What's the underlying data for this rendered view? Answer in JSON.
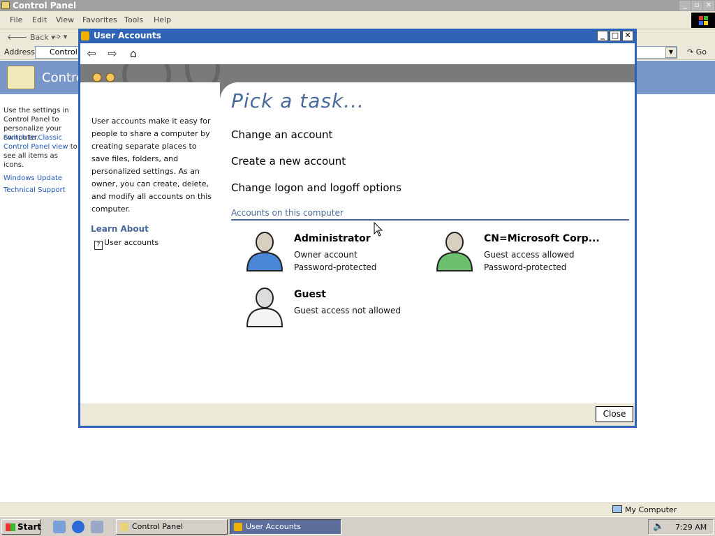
{
  "control_panel": {
    "title": "Control Panel",
    "menu": [
      "File",
      "Edit",
      "View",
      "Favorites",
      "Tools",
      "Help"
    ],
    "toolbar": {
      "back": "Back"
    },
    "address": {
      "label": "Address",
      "value": "Control Panel",
      "go": "Go"
    },
    "header_title": "Control Panel",
    "sidebar": {
      "intro": "Use the settings in Control Panel to personalize your computer.",
      "switch_link": "Switch to Classic Control Panel view",
      "switch_rest": " to see all items as icons.",
      "windows_update": "Windows Update",
      "technical_support": "Technical Support"
    }
  },
  "user_accounts": {
    "title": "User Accounts",
    "description": "User accounts make it easy for people to share a computer by creating separate places to save files, folders, and personalized settings. As an owner, you can create, delete, and modify all accounts on this computer.",
    "learn_about": "Learn About",
    "learn_link": "User accounts",
    "heading": "Pick a task...",
    "tasks": [
      "Change an account",
      "Create a new account",
      "Change logon and logoff options"
    ],
    "accounts_header": "Accounts on this computer",
    "accounts": [
      {
        "name": "Administrator",
        "line1": "Owner account",
        "line2": "Password-protected",
        "avatar_color": "#4a86d8"
      },
      {
        "name": "CN=Microsoft Corp...",
        "line1": "Guest access allowed",
        "line2": "Password-protected",
        "avatar_color": "#6cbf6c"
      },
      {
        "name": "Guest",
        "line1": "Guest access not allowed",
        "line2": "",
        "avatar_color": "#f4f4f4"
      }
    ],
    "close_button": "Close"
  },
  "status_bar": {
    "zone": "My Computer"
  },
  "taskbar": {
    "start": "Start",
    "tasks": [
      "Control Panel",
      "User Accounts"
    ],
    "clock": "7:29 AM"
  }
}
